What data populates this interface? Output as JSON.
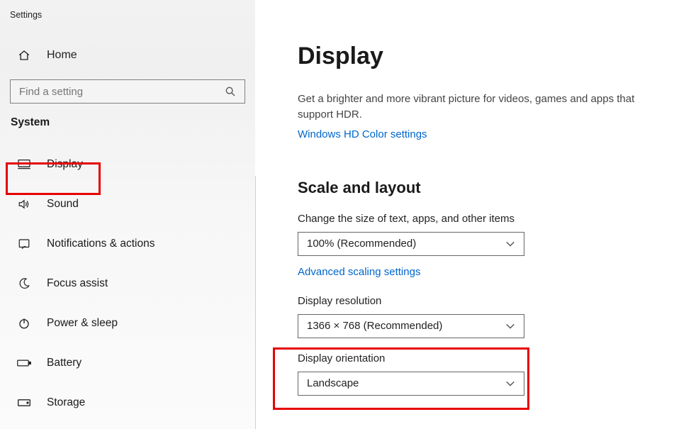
{
  "app_title": "Settings",
  "home_label": "Home",
  "search_placeholder": "Find a setting",
  "section_header": "System",
  "nav": {
    "display": "Display",
    "sound": "Sound",
    "notif": "Notifications & actions",
    "focus": "Focus assist",
    "power": "Power & sleep",
    "battery": "Battery",
    "storage": "Storage"
  },
  "page": {
    "title": "Display",
    "hdr_desc": "Get a brighter and more vibrant picture for videos, games and apps that support HDR.",
    "hdr_link": "Windows HD Color settings",
    "scale_title": "Scale and layout",
    "scale_label": "Change the size of text, apps, and other items",
    "scale_value": "100% (Recommended)",
    "adv_scaling": "Advanced scaling settings",
    "res_label": "Display resolution",
    "res_value": "1366 × 768 (Recommended)",
    "orient_label": "Display orientation",
    "orient_value": "Landscape"
  }
}
